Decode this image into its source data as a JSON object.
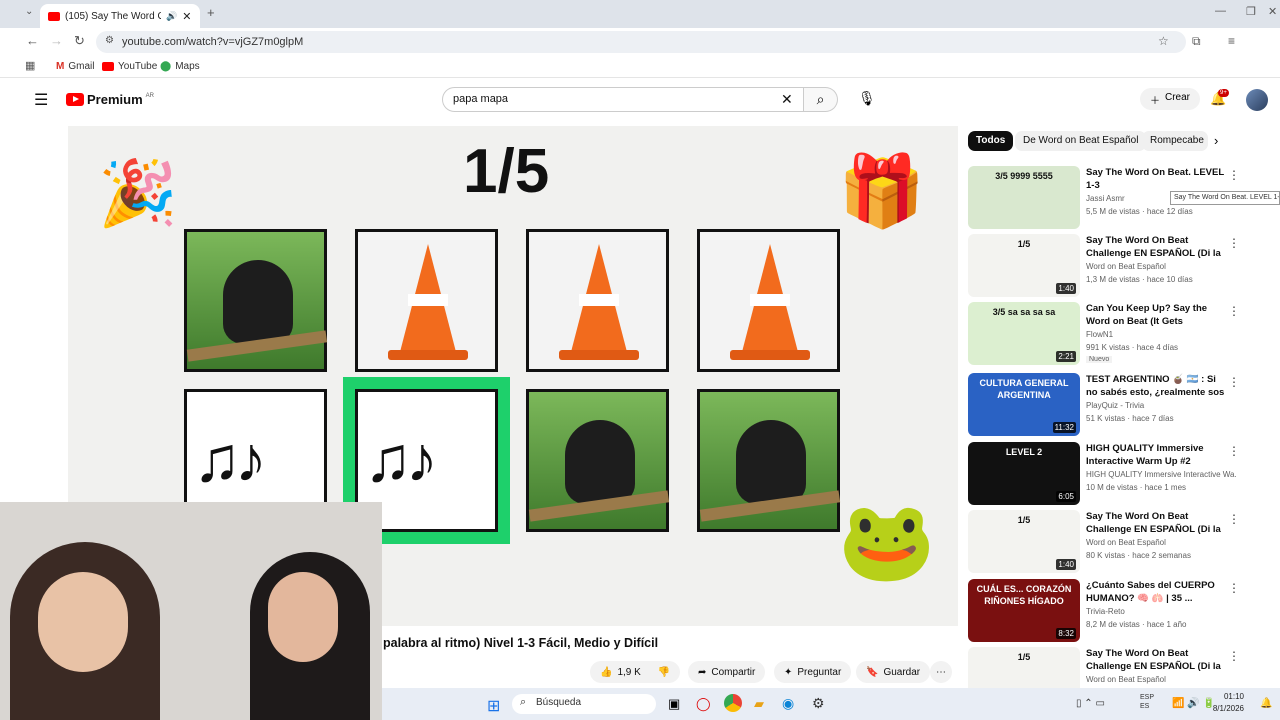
{
  "browser": {
    "tab_title": "(105) Say The Word On Be...",
    "url": "youtube.com/watch?v=vjGZ7m0glpM",
    "bookmarks": [
      "Gmail",
      "YouTube",
      "Maps"
    ]
  },
  "youtube": {
    "logo_text": "Premium",
    "logo_sup": "AR",
    "search_value": "papa mapa",
    "create_label": "Crear",
    "notif_badge": "9+"
  },
  "video": {
    "counter": "1/5",
    "grid": [
      [
        "chimp",
        "cone",
        "cone",
        "cone"
      ],
      [
        "music-notes",
        "music-notes",
        "chimp",
        "chimp"
      ]
    ],
    "active_card": "row2-col2",
    "title": "palabra al ritmo) Nivel 1-3 Fácil, Medio y Difícil",
    "likes": "1,9 K",
    "share": "Compartir",
    "ask": "Preguntar",
    "save": "Guardar"
  },
  "chips": [
    "Todos",
    "De Word on Beat Español",
    "Rompecabe"
  ],
  "recommendations": [
    {
      "title": "Say The Word On Beat. LEVEL 1-3",
      "channel": "Jassi Asmr",
      "meta": "5,5 M de vistas · hace 12 días",
      "duration": "",
      "thumb": "3/5 9999 5555",
      "bg": "#d9e8cf"
    },
    {
      "title": "Say The Word On Beat Challenge EN ESPAÑOL (Di la ...",
      "channel": "Word on Beat Español",
      "meta": "1,3 M de vistas · hace 10 días",
      "duration": "1:40",
      "thumb": "1/5",
      "bg": "#f3f3f0"
    },
    {
      "title": "Can You Keep Up? Say the Word on Beat (It Gets Impossible!)",
      "channel": "FlowN1",
      "meta": "991 K vistas · hace 4 días",
      "duration": "2:21",
      "thumb": "3/5 sa sa sa sa",
      "bg": "#dcefd0",
      "new": "Nuevo"
    },
    {
      "title": "TEST ARGENTINO 🧉 🇦🇷 : Si no sabés esto, ¿realmente sos de...",
      "channel": "PlayQuiz - Trivia",
      "meta": "51 K vistas · hace 7 días",
      "duration": "11:32",
      "thumb": "CULTURA GENERAL ARGENTINA",
      "bg": "#2a62c4"
    },
    {
      "title": "HIGH QUALITY Immersive Interactive Warm Up #2",
      "channel": "HIGH QUALITY Immersive Interactive Wa...",
      "meta": "10 M de vistas · hace 1 mes",
      "duration": "6:05",
      "thumb": "LEVEL 2",
      "bg": "#111111"
    },
    {
      "title": "Say The Word On Beat Challenge EN ESPAÑOL (Di la ...",
      "channel": "Word on Beat Español",
      "meta": "80 K vistas · hace 2 semanas",
      "duration": "1:40",
      "thumb": "1/5",
      "bg": "#f3f3f0"
    },
    {
      "title": "¿Cuánto Sabes del CUERPO HUMANO? 🧠 🫁 | 35 ...",
      "channel": "Trivia-Reto",
      "meta": "8,2 M de vistas · hace 1 año",
      "duration": "8:32",
      "thumb": "CUÁL ES... CORAZÓN RIÑONES HÍGADO",
      "bg": "#7a1010"
    },
    {
      "title": "Say The Word On Beat Challenge EN ESPAÑOL (Di la ...",
      "channel": "Word on Beat Español",
      "meta": "",
      "duration": "",
      "thumb": "1/5",
      "bg": "#f3f3f0"
    }
  ],
  "tooltip": "Say The Word On Beat. LEVEL 1-3",
  "taskbar": {
    "search": "Búsqueda",
    "lang": "ESP ES",
    "time": "01:10",
    "date": "8/1/2026"
  },
  "colors": {
    "youtube_red": "#ff0000",
    "active_outline": "#1ed06b",
    "taskbar": "#e8edf5"
  }
}
